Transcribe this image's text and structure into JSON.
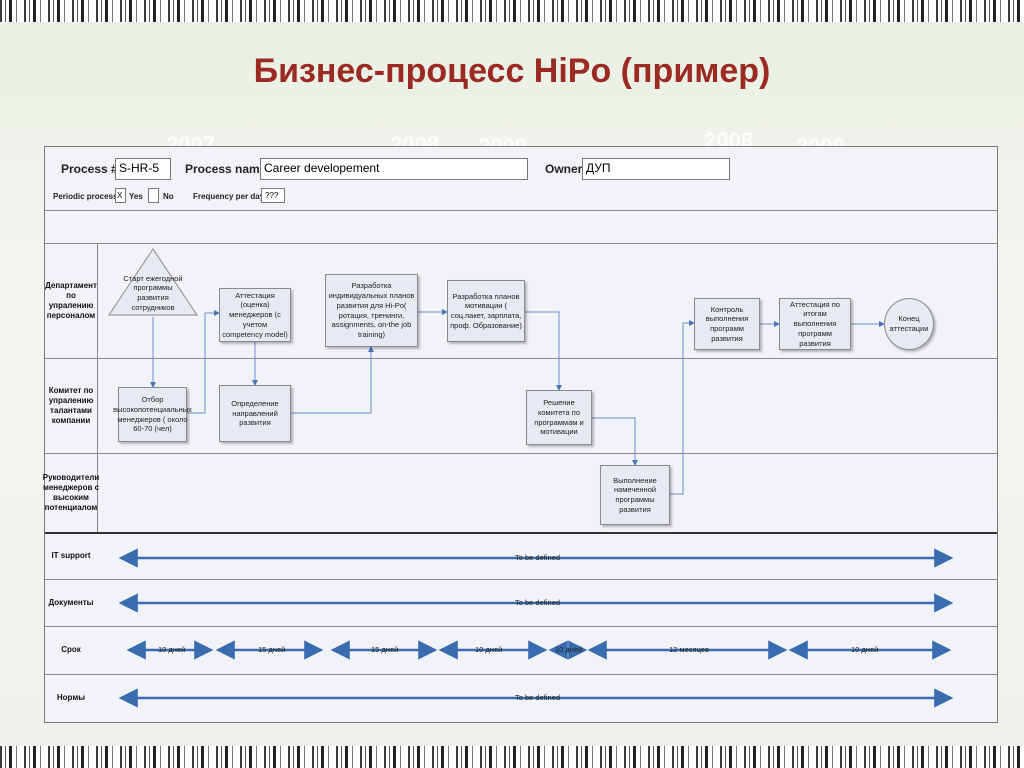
{
  "slide": {
    "title": "Бизнес-процесс HiPo (пример)"
  },
  "background_years": [
    "2007",
    "2008",
    "2009",
    "2008",
    "2009"
  ],
  "header": {
    "process_num_label": "Process #",
    "process_num_value": "S-HR-5",
    "process_name_label": "Process name",
    "process_name_value": "Career developement",
    "owner_label": "Owner",
    "owner_value": "ДУП",
    "periodic_label": "Periodic process",
    "periodic_yes_mark": "X",
    "yes_label": "Yes",
    "no_label": "No",
    "frequency_label": "Frequency per day",
    "frequency_value": "???"
  },
  "lanes": [
    "Департамент по упралению персоналом",
    "Комитет по упралению талантами компании",
    "Руководители менеджеров с высоким потенциалом",
    "IT support",
    "Документы",
    "Срок",
    "Нормы"
  ],
  "nodes": {
    "start": "Старт ежегодной программы развития сотрудников",
    "attest": "Аттестация (оценка) менеджеров (с учетом competency model)",
    "plans": "Разработка индивидуальных планов развития для Hi-Po( ротация, тренинги, assignments, on-the job training)",
    "motivation": "Разработка планов мотивации ( соц.пакет, зарплата, проф. Образование)",
    "control": "Контроль выполнения программ развития",
    "attest_results": "Аттестация по итогам выполнения программ развития",
    "end": "Конец аттестации",
    "select": "Отбор высокопотенциальных менеджеров ( около 60-70 (чел)",
    "directions": "Определение направлений развития",
    "decision": "Решение комитета по программам и мотивации",
    "execute": "Выполнение намеченной программы развития"
  },
  "rows": {
    "it_support": "To be defined",
    "documents": "To be defined",
    "norms": "To be defined",
    "terms": [
      "10 дней",
      "15 дней",
      "15 дней",
      "10 дней",
      "10 дней",
      "12 месяцев",
      "10 дней"
    ]
  },
  "colors": {
    "title": "#9b2a22",
    "arrow": "#4a77b4",
    "panel": "#f1f3f9"
  }
}
